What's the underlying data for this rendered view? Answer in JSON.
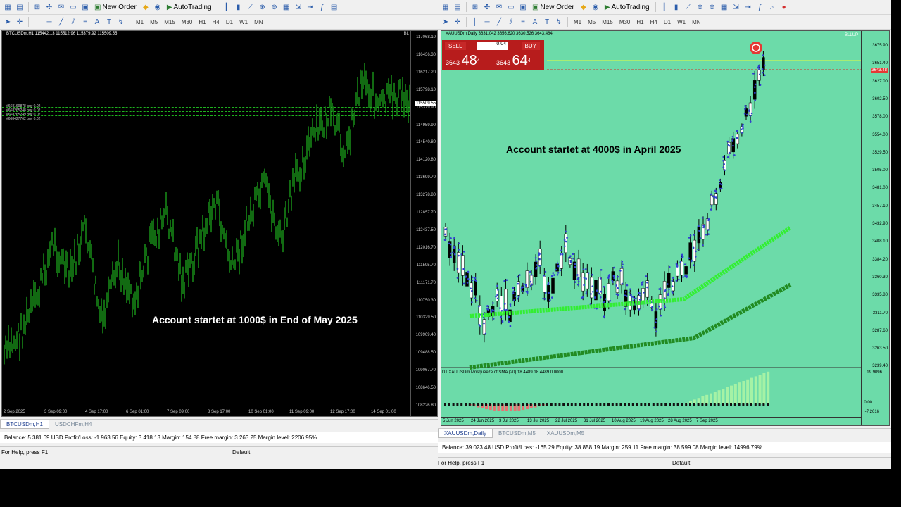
{
  "toolbar": {
    "new_order": "New Order",
    "auto_trading": "AutoTrading",
    "timeframes": [
      "M1",
      "M5",
      "M15",
      "M30",
      "H1",
      "H4",
      "D1",
      "W1",
      "MN"
    ]
  },
  "left": {
    "chart_title": "BTCUSDm,H1  115442.13 115512.96 115379.92 115509.55",
    "price_labels": [
      "117068.10",
      "116436.30",
      "116217.20",
      "115798.10",
      "115379.90",
      "114959.90",
      "114540.80",
      "114120.80",
      "113699.70",
      "113278.80",
      "112857.70",
      "112437.50",
      "112016.70",
      "111595.70",
      "111171.70",
      "110750.30",
      "110329.50",
      "109909.40",
      "109488.50",
      "109067.70",
      "108646.50",
      "108226.80"
    ],
    "current_price": "115509.55",
    "time_labels": [
      "2 Sep 2025",
      "3 Sep 09:00",
      "4 Sep 17:00",
      "6 Sep 01:00",
      "7 Sep 09:00",
      "8 Sep 17:00",
      "10 Sep 01:00",
      "11 Sep 09:00",
      "12 Sep 17:00",
      "14 Sep 01:00"
    ],
    "orders": [
      "#668169878 buy 0.02",
      "#668265248 buy 0.02",
      "#668265249 buy 0.02",
      "#668427762 buy 0.02"
    ],
    "annotation": "Account startet at 1000$ in End of May 2025",
    "tabs": [
      "BTCUSDm,H1",
      "USDCHFm,H4"
    ],
    "trade_line": "Balance: 5 381.69 USD  Profit/Loss: -1 963.56  Equity: 3 418.13  Margin: 154.88  Free margin: 3 263.25  Margin level: 2206.95%",
    "status_help": "For Help, press F1",
    "status_profile": "Default",
    "badge": "BL"
  },
  "right": {
    "chart_title": "XAUUSDm,Daily  3631.042 3656.620 3630.526 3643.484",
    "sell_label": "SELL",
    "buy_label": "BUY",
    "lot": "0.04",
    "bid_prefix": "3643",
    "bid_big": "48",
    "bid_sup": "4",
    "ask_prefix": "3643",
    "ask_big": "64",
    "ask_sup": "4",
    "price_labels": [
      "3675.90",
      "3651.40",
      "3627.00",
      "3602.50",
      "3578.00",
      "3554.00",
      "3529.50",
      "3505.00",
      "3481.00",
      "3457.10",
      "3432.90",
      "3408.10",
      "3384.20",
      "3360.30",
      "3335.80",
      "3311.70",
      "3287.60",
      "3263.50",
      "3239.40"
    ],
    "current_price": "3643.48",
    "time_labels": [
      "5 Jun 2025",
      "24 Jun 2025",
      "3 Jul 2025",
      "13 Jul 2025",
      "22 Jul 2025",
      "31 Jul 2025",
      "10 Aug 2025",
      "19 Aug 2025",
      "28 Aug 2025",
      "7 Sep 2025"
    ],
    "annotation": "Account startet at 4000$ in April 2025",
    "indicator_title": "D1 XAUUSDm Mnsqueeze of SMA (20) 18.4489 18.4489 0.0000",
    "indicator_labels": [
      "19.9096",
      "0.00",
      "-7.2616"
    ],
    "tabs": [
      "XAUUSDm,Daily",
      "BTCUSDm,M5",
      "XAUUSDm,M5"
    ],
    "trade_line": "Balance: 39 023.48 USD  Profit/Loss: -165.29  Equity: 38 858.19  Margin: 259.11  Free margin: 38 599.08  Margin level: 14996.79%",
    "status_help": "For Help, press F1",
    "status_profile": "Default",
    "badge": "BLLUP"
  },
  "colors": {
    "left_bg": "#000000",
    "left_candles": "#1fb21f",
    "right_bg": "#6cdba9",
    "annotation_left": "#ffffff",
    "annotation_right": "#000000",
    "trade_panel": "#b71c1c"
  }
}
